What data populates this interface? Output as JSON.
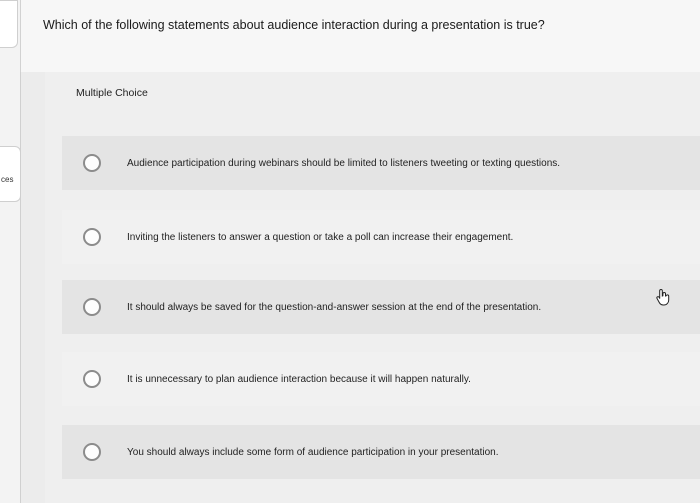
{
  "sidebar": {
    "tab_fragment": "ces"
  },
  "question": {
    "text": "Which of the following statements about audience interaction during a presentation is true?",
    "type_label": "Multiple Choice"
  },
  "options": [
    {
      "label": "Audience participation during webinars should be limited to listeners tweeting or texting questions.",
      "selected": false
    },
    {
      "label": "Inviting the listeners to answer a question or take a poll can increase their engagement.",
      "selected": false
    },
    {
      "label": "It should always be saved for the question-and-answer session at the end of the presentation.",
      "selected": false
    },
    {
      "label": "It is unnecessary to plan audience interaction because it will happen naturally.",
      "selected": false
    },
    {
      "label": "You should always include some form of audience participation in your presentation.",
      "selected": false
    }
  ],
  "icons": {
    "cursor": "pointer-hand-icon",
    "radio": "radio-unchecked-icon"
  }
}
